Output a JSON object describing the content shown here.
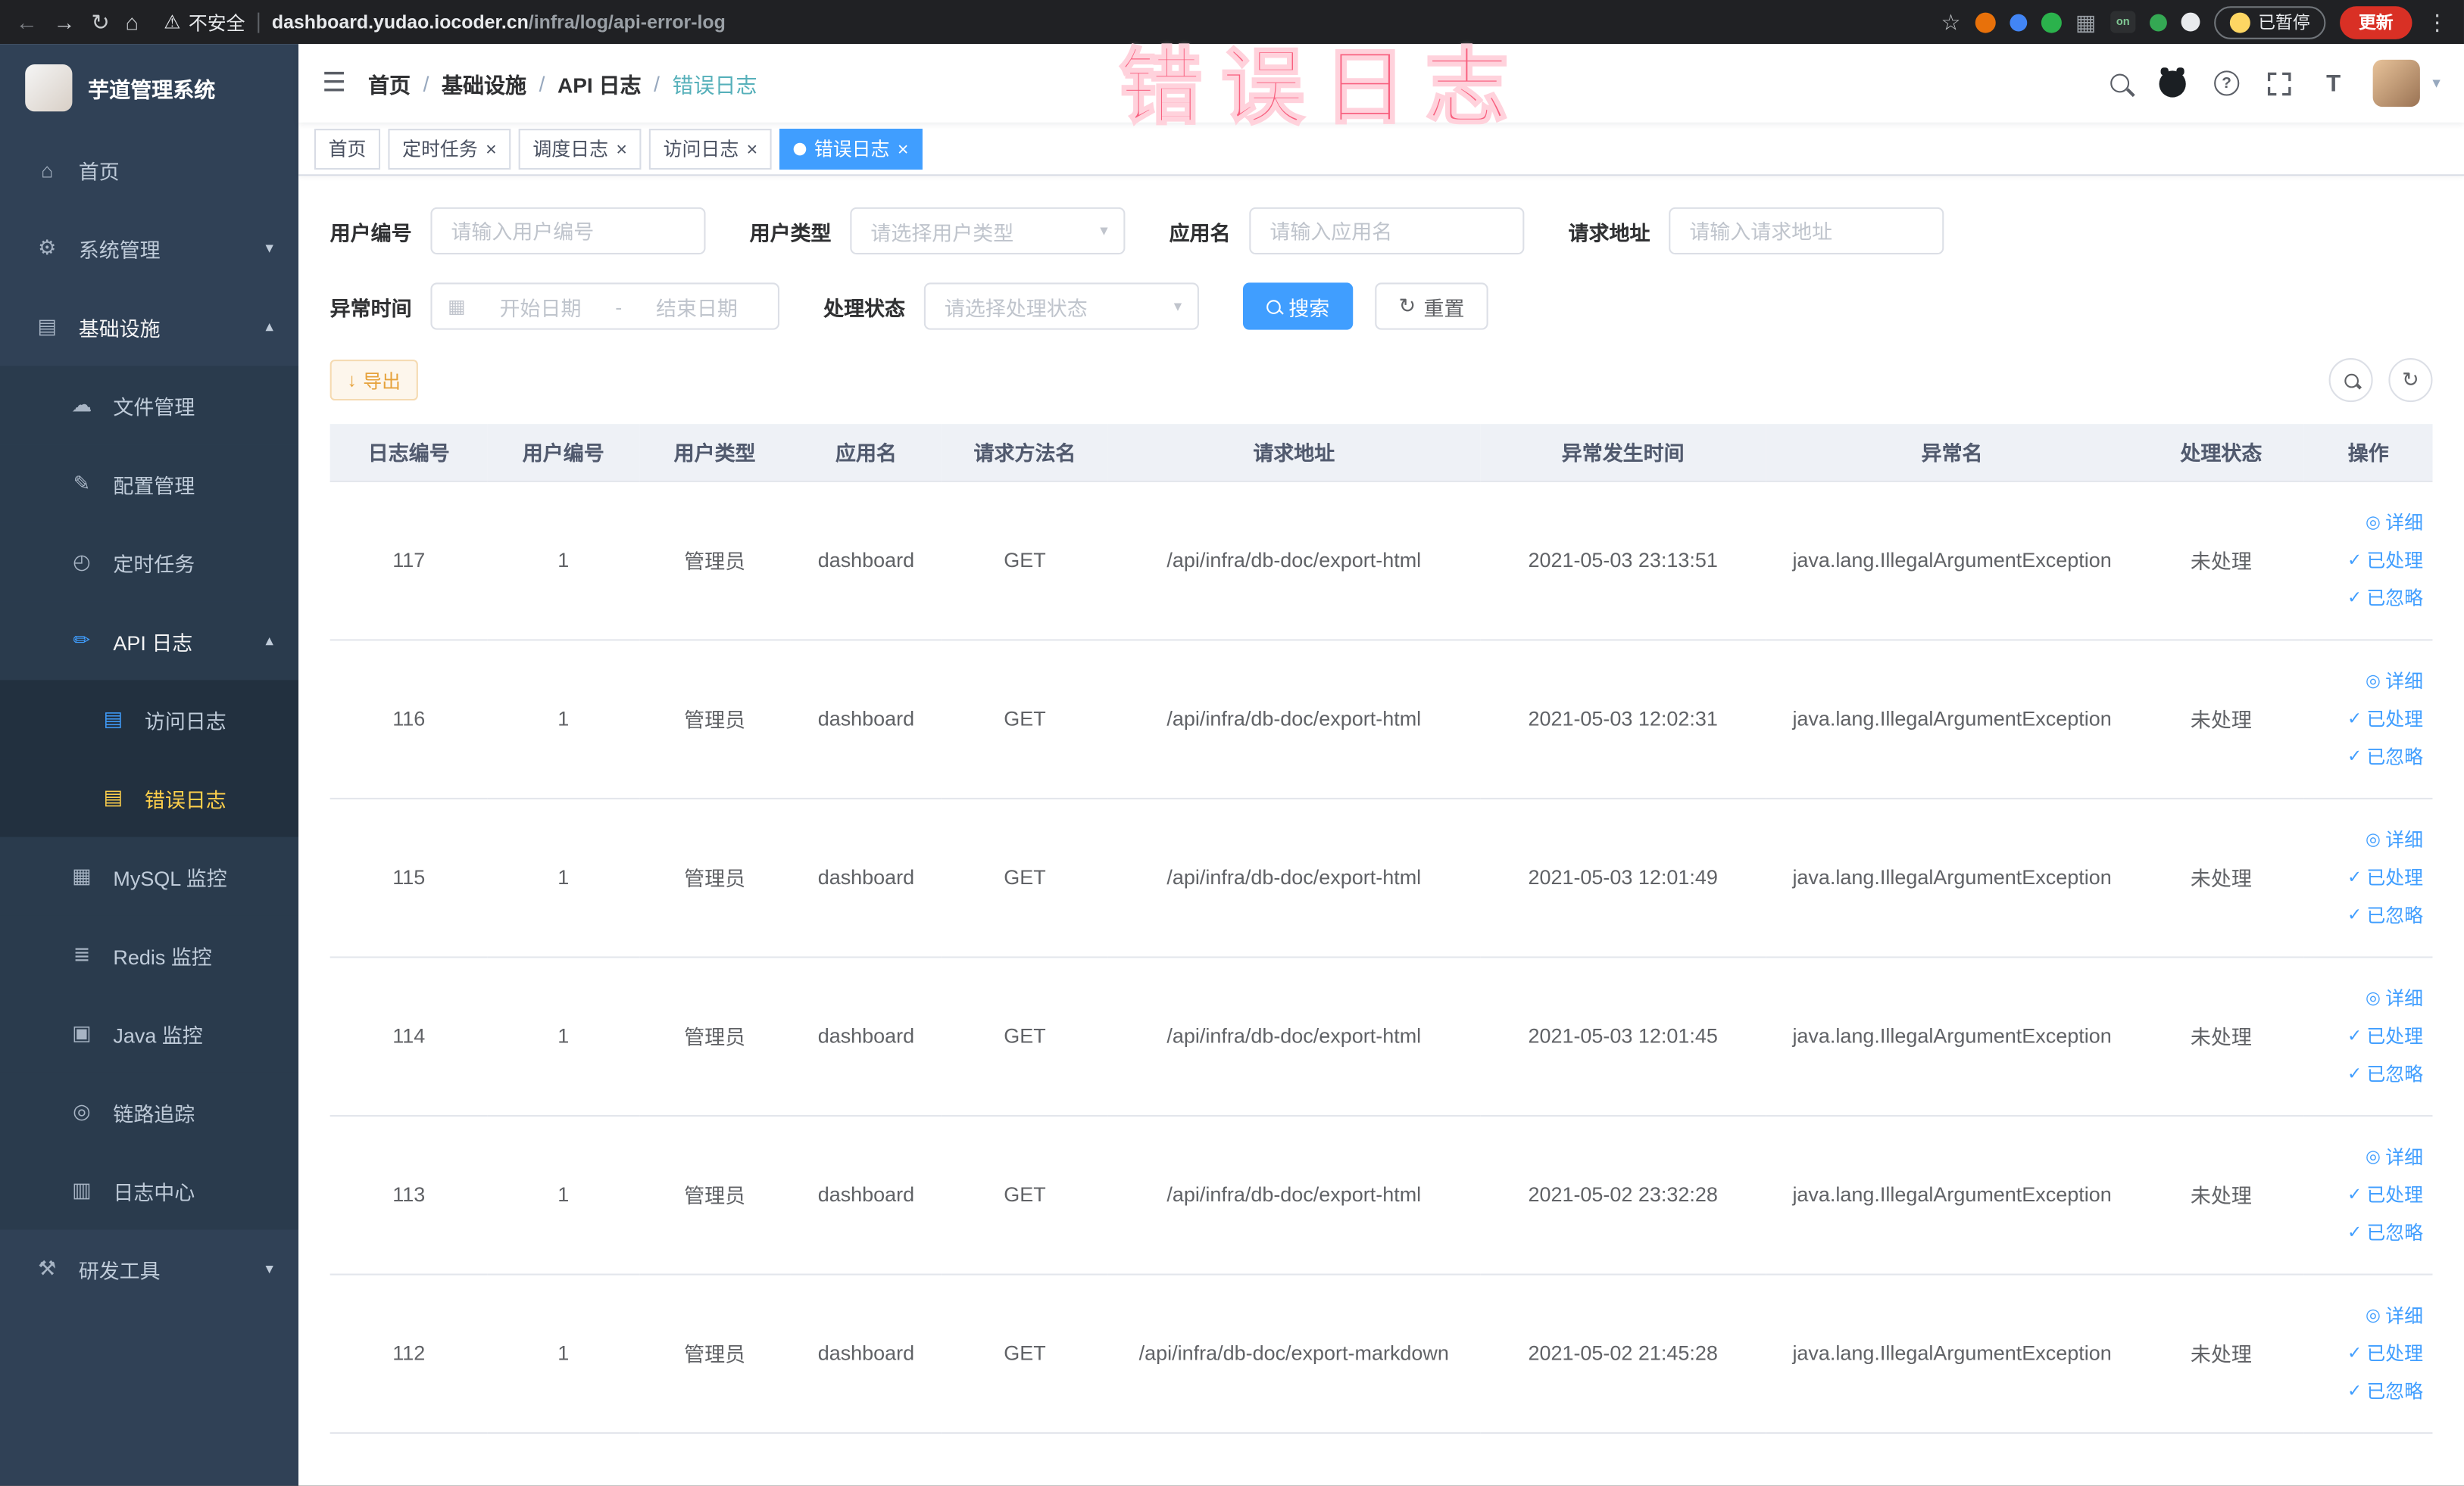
{
  "browser": {
    "security_label": "不安全",
    "url_domain": "dashboard.yudao.iocoder.cn",
    "url_path": "/infra/log/api-error-log",
    "paused_label": "已暂停",
    "update_label": "更新"
  },
  "overlay_text": "错误日志",
  "sidebar": {
    "logo_title": "芋道管理系统",
    "items": [
      {
        "label": "首页",
        "level": 1
      },
      {
        "label": "系统管理",
        "level": 1,
        "expandable": true,
        "expanded": false
      },
      {
        "label": "基础设施",
        "level": 1,
        "expandable": true,
        "expanded": true
      },
      {
        "label": "文件管理",
        "level": 2
      },
      {
        "label": "配置管理",
        "level": 2
      },
      {
        "label": "定时任务",
        "level": 2
      },
      {
        "label": "API 日志",
        "level": 2,
        "expandable": true,
        "expanded": true
      },
      {
        "label": "访问日志",
        "level": 3
      },
      {
        "label": "错误日志",
        "level": 3,
        "active": true
      },
      {
        "label": "MySQL 监控",
        "level": 2
      },
      {
        "label": "Redis 监控",
        "level": 2
      },
      {
        "label": "Java 监控",
        "level": 2
      },
      {
        "label": "链路追踪",
        "level": 2
      },
      {
        "label": "日志中心",
        "level": 2
      },
      {
        "label": "研发工具",
        "level": 1,
        "expandable": true,
        "expanded": false
      }
    ]
  },
  "breadcrumb": {
    "separator": "/",
    "items": [
      "首页",
      "基础设施",
      "API 日志",
      "错误日志"
    ]
  },
  "tags": [
    {
      "label": "首页",
      "closable": false,
      "active": false
    },
    {
      "label": "定时任务",
      "closable": true,
      "active": false
    },
    {
      "label": "调度日志",
      "closable": true,
      "active": false
    },
    {
      "label": "访问日志",
      "closable": true,
      "active": false
    },
    {
      "label": "错误日志",
      "closable": true,
      "active": true
    }
  ],
  "filters": {
    "user_id_label": "用户编号",
    "user_id_placeholder": "请输入用户编号",
    "user_type_label": "用户类型",
    "user_type_placeholder": "请选择用户类型",
    "app_name_label": "应用名",
    "app_name_placeholder": "请输入应用名",
    "request_url_label": "请求地址",
    "request_url_placeholder": "请输入请求地址",
    "exception_time_label": "异常时间",
    "date_start_placeholder": "开始日期",
    "date_end_placeholder": "结束日期",
    "date_separator": "-",
    "process_status_label": "处理状态",
    "process_status_placeholder": "请选择处理状态",
    "search_label": "搜索",
    "reset_label": "重置"
  },
  "toolbar": {
    "export_label": "导出"
  },
  "table": {
    "columns": [
      "日志编号",
      "用户编号",
      "用户类型",
      "应用名",
      "请求方法名",
      "请求地址",
      "异常发生时间",
      "异常名",
      "处理状态",
      "操作"
    ],
    "action_detail": "详细",
    "action_processed": "已处理",
    "action_ignored": "已忽略",
    "rows": [
      {
        "id": "117",
        "user_id": "1",
        "user_type": "管理员",
        "app": "dashboard",
        "method": "GET",
        "url": "/api/infra/db-doc/export-html",
        "time": "2021-05-03 23:13:51",
        "exception": "java.lang.IllegalArgumentException",
        "status": "未处理"
      },
      {
        "id": "116",
        "user_id": "1",
        "user_type": "管理员",
        "app": "dashboard",
        "method": "GET",
        "url": "/api/infra/db-doc/export-html",
        "time": "2021-05-03 12:02:31",
        "exception": "java.lang.IllegalArgumentException",
        "status": "未处理"
      },
      {
        "id": "115",
        "user_id": "1",
        "user_type": "管理员",
        "app": "dashboard",
        "method": "GET",
        "url": "/api/infra/db-doc/export-html",
        "time": "2021-05-03 12:01:49",
        "exception": "java.lang.IllegalArgumentException",
        "status": "未处理"
      },
      {
        "id": "114",
        "user_id": "1",
        "user_type": "管理员",
        "app": "dashboard",
        "method": "GET",
        "url": "/api/infra/db-doc/export-html",
        "time": "2021-05-03 12:01:45",
        "exception": "java.lang.IllegalArgumentException",
        "status": "未处理"
      },
      {
        "id": "113",
        "user_id": "1",
        "user_type": "管理员",
        "app": "dashboard",
        "method": "GET",
        "url": "/api/infra/db-doc/export-html",
        "time": "2021-05-02 23:32:28",
        "exception": "java.lang.IllegalArgumentException",
        "status": "未处理"
      },
      {
        "id": "112",
        "user_id": "1",
        "user_type": "管理员",
        "app": "dashboard",
        "method": "GET",
        "url": "/api/infra/db-doc/export-markdown",
        "time": "2021-05-02 21:45:28",
        "exception": "java.lang.IllegalArgumentException",
        "status": "未处理"
      }
    ]
  },
  "icons": {
    "back": "←",
    "forward": "→",
    "reload": "↻",
    "home": "⌂",
    "warning": "⚠",
    "star": "☆",
    "kebab": "⋮",
    "hamburger": "☰",
    "caret_down": "▾",
    "caret_up": "▴",
    "close": "×",
    "grid": "▦",
    "calendar": "▦",
    "reset": "↻",
    "export": "↓",
    "check": "✓",
    "eye": "◎",
    "question": "?",
    "font_size": "T",
    "menu_home": "⌂",
    "menu_system": "⚙",
    "menu_infra": "▤",
    "menu_file": "☁",
    "menu_config": "✎",
    "menu_job": "◴",
    "menu_api_log": "✏",
    "menu_access_log": "▤",
    "menu_error_log": "▤",
    "menu_mysql": "▦",
    "menu_redis": "≣",
    "menu_java": "▣",
    "menu_trace": "◎",
    "menu_log_center": "▥",
    "menu_devtools": "⚒"
  }
}
